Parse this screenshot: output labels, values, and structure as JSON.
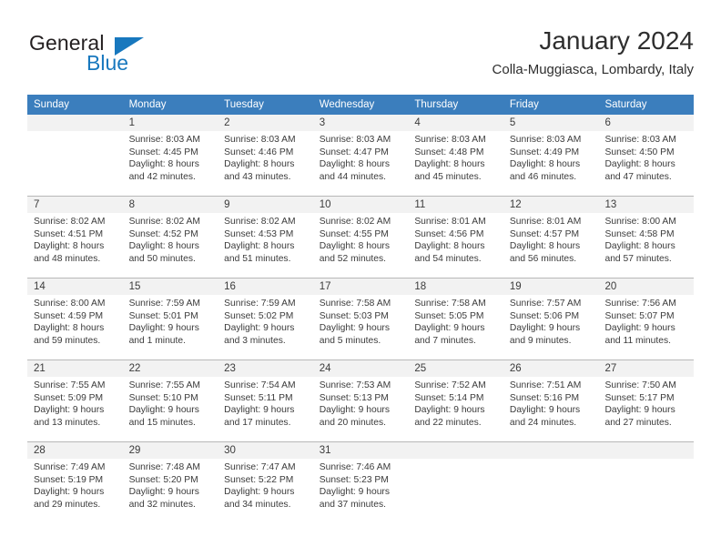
{
  "branding": {
    "logo_text_top": "General",
    "logo_text_bottom": "Blue",
    "logo_triangle_icon": "blue-triangle-icon",
    "accent_color": "#1878be"
  },
  "header": {
    "title": "January 2024",
    "subtitle": "Colla-Muggiasca, Lombardy, Italy"
  },
  "calendar": {
    "header_bg_color": "#3b7ebd",
    "daynum_band_color": "#f2f2f2",
    "weekdays": [
      "Sunday",
      "Monday",
      "Tuesday",
      "Wednesday",
      "Thursday",
      "Friday",
      "Saturday"
    ],
    "weeks": [
      [
        {
          "day": "",
          "sunrise": "",
          "sunset": "",
          "daylight_hours": "",
          "daylight_minutes": "",
          "empty": true
        },
        {
          "day": "1",
          "sunrise": "Sunrise: 8:03 AM",
          "sunset": "Sunset: 4:45 PM",
          "daylight_hours": "Daylight: 8 hours",
          "daylight_minutes": "and 42 minutes."
        },
        {
          "day": "2",
          "sunrise": "Sunrise: 8:03 AM",
          "sunset": "Sunset: 4:46 PM",
          "daylight_hours": "Daylight: 8 hours",
          "daylight_minutes": "and 43 minutes."
        },
        {
          "day": "3",
          "sunrise": "Sunrise: 8:03 AM",
          "sunset": "Sunset: 4:47 PM",
          "daylight_hours": "Daylight: 8 hours",
          "daylight_minutes": "and 44 minutes."
        },
        {
          "day": "4",
          "sunrise": "Sunrise: 8:03 AM",
          "sunset": "Sunset: 4:48 PM",
          "daylight_hours": "Daylight: 8 hours",
          "daylight_minutes": "and 45 minutes."
        },
        {
          "day": "5",
          "sunrise": "Sunrise: 8:03 AM",
          "sunset": "Sunset: 4:49 PM",
          "daylight_hours": "Daylight: 8 hours",
          "daylight_minutes": "and 46 minutes."
        },
        {
          "day": "6",
          "sunrise": "Sunrise: 8:03 AM",
          "sunset": "Sunset: 4:50 PM",
          "daylight_hours": "Daylight: 8 hours",
          "daylight_minutes": "and 47 minutes."
        }
      ],
      [
        {
          "day": "7",
          "sunrise": "Sunrise: 8:02 AM",
          "sunset": "Sunset: 4:51 PM",
          "daylight_hours": "Daylight: 8 hours",
          "daylight_minutes": "and 48 minutes."
        },
        {
          "day": "8",
          "sunrise": "Sunrise: 8:02 AM",
          "sunset": "Sunset: 4:52 PM",
          "daylight_hours": "Daylight: 8 hours",
          "daylight_minutes": "and 50 minutes."
        },
        {
          "day": "9",
          "sunrise": "Sunrise: 8:02 AM",
          "sunset": "Sunset: 4:53 PM",
          "daylight_hours": "Daylight: 8 hours",
          "daylight_minutes": "and 51 minutes."
        },
        {
          "day": "10",
          "sunrise": "Sunrise: 8:02 AM",
          "sunset": "Sunset: 4:55 PM",
          "daylight_hours": "Daylight: 8 hours",
          "daylight_minutes": "and 52 minutes."
        },
        {
          "day": "11",
          "sunrise": "Sunrise: 8:01 AM",
          "sunset": "Sunset: 4:56 PM",
          "daylight_hours": "Daylight: 8 hours",
          "daylight_minutes": "and 54 minutes."
        },
        {
          "day": "12",
          "sunrise": "Sunrise: 8:01 AM",
          "sunset": "Sunset: 4:57 PM",
          "daylight_hours": "Daylight: 8 hours",
          "daylight_minutes": "and 56 minutes."
        },
        {
          "day": "13",
          "sunrise": "Sunrise: 8:00 AM",
          "sunset": "Sunset: 4:58 PM",
          "daylight_hours": "Daylight: 8 hours",
          "daylight_minutes": "and 57 minutes."
        }
      ],
      [
        {
          "day": "14",
          "sunrise": "Sunrise: 8:00 AM",
          "sunset": "Sunset: 4:59 PM",
          "daylight_hours": "Daylight: 8 hours",
          "daylight_minutes": "and 59 minutes."
        },
        {
          "day": "15",
          "sunrise": "Sunrise: 7:59 AM",
          "sunset": "Sunset: 5:01 PM",
          "daylight_hours": "Daylight: 9 hours",
          "daylight_minutes": "and 1 minute."
        },
        {
          "day": "16",
          "sunrise": "Sunrise: 7:59 AM",
          "sunset": "Sunset: 5:02 PM",
          "daylight_hours": "Daylight: 9 hours",
          "daylight_minutes": "and 3 minutes."
        },
        {
          "day": "17",
          "sunrise": "Sunrise: 7:58 AM",
          "sunset": "Sunset: 5:03 PM",
          "daylight_hours": "Daylight: 9 hours",
          "daylight_minutes": "and 5 minutes."
        },
        {
          "day": "18",
          "sunrise": "Sunrise: 7:58 AM",
          "sunset": "Sunset: 5:05 PM",
          "daylight_hours": "Daylight: 9 hours",
          "daylight_minutes": "and 7 minutes."
        },
        {
          "day": "19",
          "sunrise": "Sunrise: 7:57 AM",
          "sunset": "Sunset: 5:06 PM",
          "daylight_hours": "Daylight: 9 hours",
          "daylight_minutes": "and 9 minutes."
        },
        {
          "day": "20",
          "sunrise": "Sunrise: 7:56 AM",
          "sunset": "Sunset: 5:07 PM",
          "daylight_hours": "Daylight: 9 hours",
          "daylight_minutes": "and 11 minutes."
        }
      ],
      [
        {
          "day": "21",
          "sunrise": "Sunrise: 7:55 AM",
          "sunset": "Sunset: 5:09 PM",
          "daylight_hours": "Daylight: 9 hours",
          "daylight_minutes": "and 13 minutes."
        },
        {
          "day": "22",
          "sunrise": "Sunrise: 7:55 AM",
          "sunset": "Sunset: 5:10 PM",
          "daylight_hours": "Daylight: 9 hours",
          "daylight_minutes": "and 15 minutes."
        },
        {
          "day": "23",
          "sunrise": "Sunrise: 7:54 AM",
          "sunset": "Sunset: 5:11 PM",
          "daylight_hours": "Daylight: 9 hours",
          "daylight_minutes": "and 17 minutes."
        },
        {
          "day": "24",
          "sunrise": "Sunrise: 7:53 AM",
          "sunset": "Sunset: 5:13 PM",
          "daylight_hours": "Daylight: 9 hours",
          "daylight_minutes": "and 20 minutes."
        },
        {
          "day": "25",
          "sunrise": "Sunrise: 7:52 AM",
          "sunset": "Sunset: 5:14 PM",
          "daylight_hours": "Daylight: 9 hours",
          "daylight_minutes": "and 22 minutes."
        },
        {
          "day": "26",
          "sunrise": "Sunrise: 7:51 AM",
          "sunset": "Sunset: 5:16 PM",
          "daylight_hours": "Daylight: 9 hours",
          "daylight_minutes": "and 24 minutes."
        },
        {
          "day": "27",
          "sunrise": "Sunrise: 7:50 AM",
          "sunset": "Sunset: 5:17 PM",
          "daylight_hours": "Daylight: 9 hours",
          "daylight_minutes": "and 27 minutes."
        }
      ],
      [
        {
          "day": "28",
          "sunrise": "Sunrise: 7:49 AM",
          "sunset": "Sunset: 5:19 PM",
          "daylight_hours": "Daylight: 9 hours",
          "daylight_minutes": "and 29 minutes."
        },
        {
          "day": "29",
          "sunrise": "Sunrise: 7:48 AM",
          "sunset": "Sunset: 5:20 PM",
          "daylight_hours": "Daylight: 9 hours",
          "daylight_minutes": "and 32 minutes."
        },
        {
          "day": "30",
          "sunrise": "Sunrise: 7:47 AM",
          "sunset": "Sunset: 5:22 PM",
          "daylight_hours": "Daylight: 9 hours",
          "daylight_minutes": "and 34 minutes."
        },
        {
          "day": "31",
          "sunrise": "Sunrise: 7:46 AM",
          "sunset": "Sunset: 5:23 PM",
          "daylight_hours": "Daylight: 9 hours",
          "daylight_minutes": "and 37 minutes."
        },
        {
          "day": "",
          "sunrise": "",
          "sunset": "",
          "daylight_hours": "",
          "daylight_minutes": "",
          "empty": true
        },
        {
          "day": "",
          "sunrise": "",
          "sunset": "",
          "daylight_hours": "",
          "daylight_minutes": "",
          "empty": true
        },
        {
          "day": "",
          "sunrise": "",
          "sunset": "",
          "daylight_hours": "",
          "daylight_minutes": "",
          "empty": true
        }
      ]
    ]
  }
}
